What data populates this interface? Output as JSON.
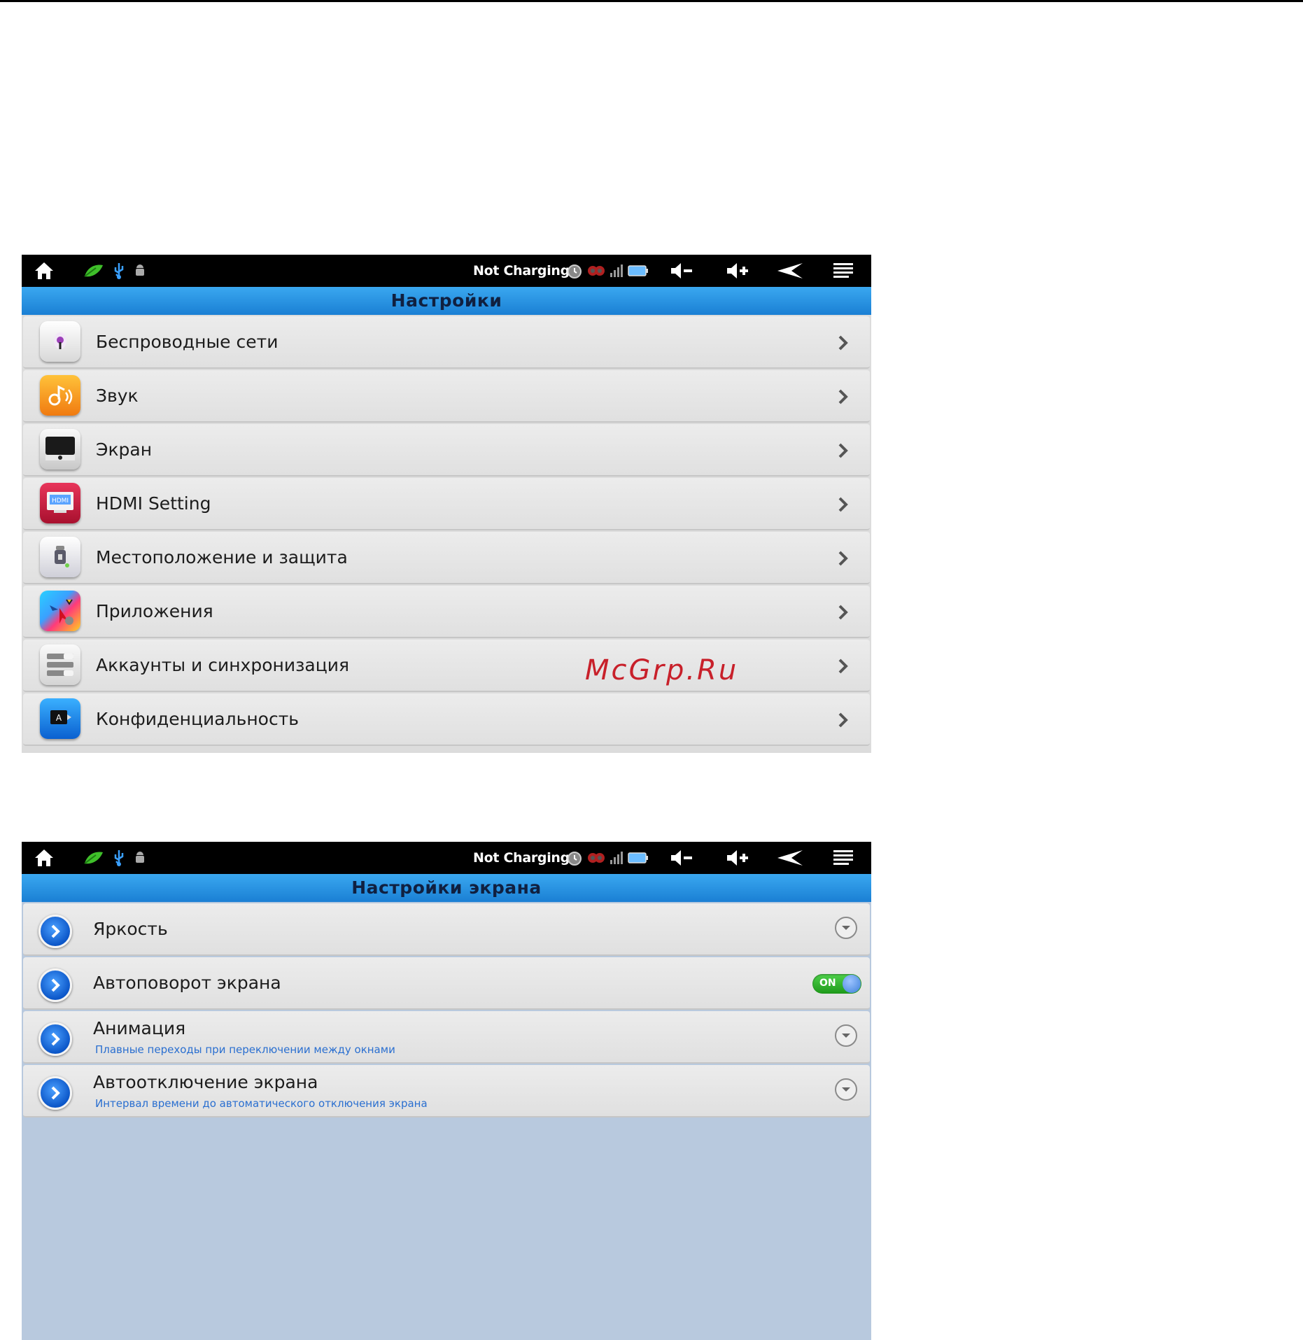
{
  "statusbar": {
    "charging_text": "Not Charging"
  },
  "settings_screen": {
    "title": "Настройки",
    "items": [
      {
        "label": "Беспроводные сети",
        "icon": "wireless-icon"
      },
      {
        "label": "Звук",
        "icon": "sound-icon"
      },
      {
        "label": "Экран",
        "icon": "display-icon"
      },
      {
        "label": "HDMI Setting",
        "icon": "hdmi-icon",
        "icon_text": "HDMI"
      },
      {
        "label": "Местоположение и защита",
        "icon": "location-security-icon"
      },
      {
        "label": "Приложения",
        "icon": "applications-icon"
      },
      {
        "label": "Аккаунты и синхронизация",
        "icon": "accounts-sync-icon"
      },
      {
        "label": "Конфиденциальность",
        "icon": "privacy-icon"
      }
    ]
  },
  "display_screen": {
    "title": "Настройки экрана",
    "items": [
      {
        "label": "Яркость",
        "control": "dropdown"
      },
      {
        "label": "Автоповорот экрана",
        "control": "toggle",
        "toggle_text": "ON"
      },
      {
        "label": "Анимация",
        "sub": "Плавные переходы при переключении между окнами",
        "control": "dropdown"
      },
      {
        "label": "Автоотключение экрана",
        "sub": "Интервал времени до автоматического отключения экрана",
        "control": "dropdown"
      }
    ]
  },
  "watermark": "McGrp.Ru",
  "colors": {
    "accent": "#1a7fd4",
    "statusbar": "#000000",
    "toggle_on": "#2fb52a",
    "subtext": "#2a6fd0",
    "watermark": "#c8202a"
  }
}
